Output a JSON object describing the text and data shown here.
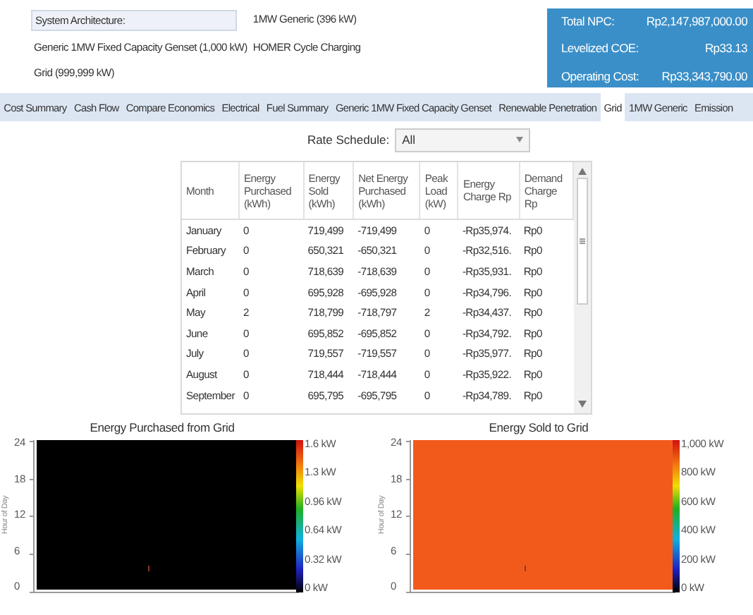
{
  "header": {
    "fields": [
      {
        "kind": "label",
        "text": "System Architecture:"
      },
      {
        "kind": "value",
        "text": "1MW Generic (396 kW)"
      },
      {
        "kind": "value",
        "text": "Generic 1MW Fixed Capacity Genset (1,000 kW)"
      },
      {
        "kind": "value",
        "text": "HOMER Cycle Charging"
      },
      {
        "kind": "value",
        "text": "Grid (999,999 kW)"
      }
    ],
    "summary": [
      {
        "label": "Total NPC:",
        "value": "Rp2,147,987,000.00"
      },
      {
        "label": "Levelized COE:",
        "value": "Rp33.13"
      },
      {
        "label": "Operating Cost:",
        "value": "Rp33,343,790.00"
      }
    ]
  },
  "tabs": [
    {
      "label": "Cost Summary",
      "selected": false
    },
    {
      "label": "Cash Flow",
      "selected": false
    },
    {
      "label": "Compare Economics",
      "selected": false
    },
    {
      "label": "Electrical",
      "selected": false
    },
    {
      "label": "Fuel Summary",
      "selected": false
    },
    {
      "label": "Generic 1MW Fixed Capacity Genset",
      "selected": false
    },
    {
      "label": "Renewable Penetration",
      "selected": false
    },
    {
      "label": "Grid",
      "selected": true
    },
    {
      "label": "1MW Generic",
      "selected": false
    },
    {
      "label": "Emission",
      "selected": false
    }
  ],
  "rate_schedule": {
    "label": "Rate Schedule:",
    "value": "All"
  },
  "table": {
    "columns": [
      "Month",
      "Energy Purchased (kWh)",
      "Energy Sold (kWh)",
      "Net Energy Purchased (kWh)",
      "Peak Load (kW)",
      "Energy Charge Rp",
      "Demand Charge Rp"
    ],
    "rows": [
      [
        "January",
        "0",
        "719,499",
        "-719,499",
        "0",
        "-Rp35,974.",
        "Rp0"
      ],
      [
        "February",
        "0",
        "650,321",
        "-650,321",
        "0",
        "-Rp32,516.",
        "Rp0"
      ],
      [
        "March",
        "0",
        "718,639",
        "-718,639",
        "0",
        "-Rp35,931.",
        "Rp0"
      ],
      [
        "April",
        "0",
        "695,928",
        "-695,928",
        "0",
        "-Rp34,796.",
        "Rp0"
      ],
      [
        "May",
        "2",
        "718,799",
        "-718,797",
        "2",
        "-Rp34,437.",
        "Rp0"
      ],
      [
        "June",
        "0",
        "695,852",
        "-695,852",
        "0",
        "-Rp34,792.",
        "Rp0"
      ],
      [
        "July",
        "0",
        "719,557",
        "-719,557",
        "0",
        "-Rp35,977.",
        "Rp0"
      ],
      [
        "August",
        "0",
        "718,444",
        "-718,444",
        "0",
        "-Rp35,922.",
        "Rp0"
      ],
      [
        "September",
        "0",
        "695,795",
        "-695,795",
        "0",
        "-Rp34,789.",
        "Rp0"
      ]
    ]
  },
  "charts": [
    {
      "title": "Energy Purchased from Grid",
      "y_axis_title": "Hour of Day",
      "y_ticks": [
        "24",
        "18",
        "12",
        "6",
        "0"
      ],
      "color": "#000000",
      "scale_labels": [
        "1.6 kW",
        "1.3 kW",
        "0.96 kW",
        "0.64 kW",
        "0.32 kW",
        "0 kW"
      ]
    },
    {
      "title": "Energy Sold to Grid",
      "y_axis_title": "Hour of Day",
      "y_ticks": [
        "24",
        "18",
        "12",
        "6",
        "0"
      ],
      "color": "#f25a1c",
      "scale_labels": [
        "1,000 kW",
        "800 kW",
        "600 kW",
        "400 kW",
        "200 kW",
        "0 kW"
      ]
    }
  ]
}
